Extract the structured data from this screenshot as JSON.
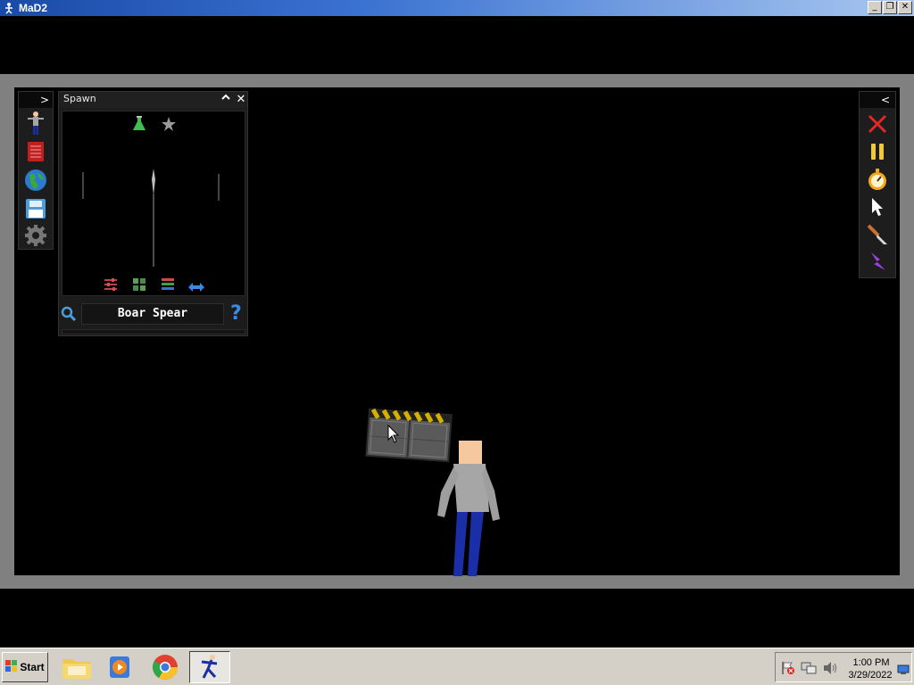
{
  "window": {
    "title": "MaD2",
    "minimize_label": "_",
    "restore_label": "❐",
    "close_label": "✕"
  },
  "left_toolbar": {
    "collapse_label": ">",
    "items": [
      "human-icon",
      "catalog-book-icon",
      "globe-icon",
      "save-disk-icon",
      "settings-gear-icon"
    ]
  },
  "spawn_panel": {
    "title": "Spawn",
    "collapse_label": "^",
    "close_label": "✕",
    "filter_tabs": [
      "flask-icon",
      "star-icon"
    ],
    "view_options": [
      "sliders-icon",
      "grid-view-icon",
      "list-view-icon",
      "arrows-horizontal-icon"
    ],
    "selected_item": "Boar Spear",
    "help_label": "?"
  },
  "right_toolbar": {
    "collapse_label": "<",
    "items": [
      "clear-x-icon",
      "pause-icon",
      "stopwatch-icon",
      "pointer-icon",
      "knife-icon",
      "lightning-icon"
    ]
  },
  "taskbar": {
    "start_label": "Start",
    "apps": [
      "file-explorer-icon",
      "media-player-icon",
      "chrome-icon",
      "mad2-app-icon"
    ],
    "time": "1:00 PM",
    "date": "3/29/2022"
  },
  "colors": {
    "game_bg": "#000000",
    "frame": "#808080",
    "title_start": "#1a4aa8",
    "taskbar": "#d4d0c8"
  }
}
